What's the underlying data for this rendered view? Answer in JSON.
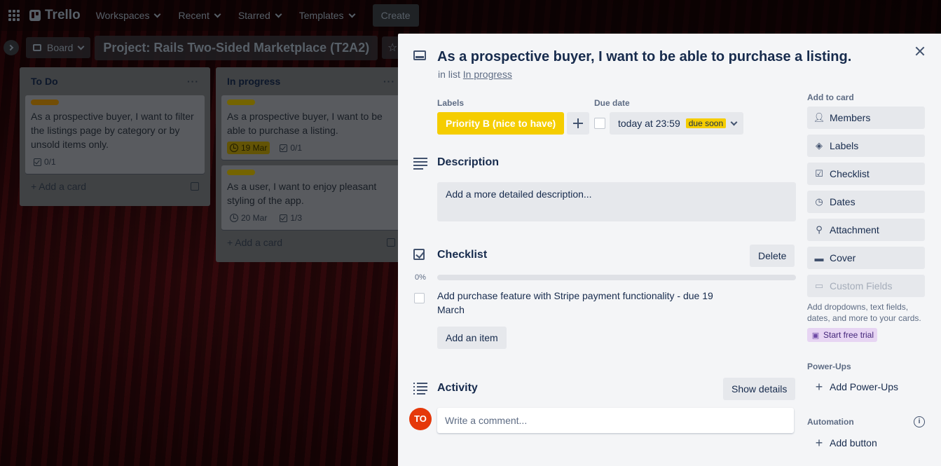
{
  "nav": {
    "logo": "Trello",
    "items": [
      "Workspaces",
      "Recent",
      "Starred",
      "Templates"
    ],
    "create": "Create"
  },
  "board": {
    "view": "Board",
    "title": "Project: Rails Two-Sided Marketplace (T2A2)"
  },
  "lists": [
    {
      "title": "To Do",
      "cards": [
        {
          "label_color": "#cf8c0a",
          "text": "As a prospective buyer, I want to filter the listings page by category or by unsold items only.",
          "checklist": "0/1"
        }
      ],
      "add_card": "Add a card"
    },
    {
      "title": "In progress",
      "cards": [
        {
          "label_color": "#d4b700",
          "text": "As a prospective buyer, I want to be able to purchase a listing.",
          "due": "19 Mar",
          "checklist": "0/1"
        },
        {
          "label_color": "#d4b700",
          "text": "As a user, I want to enjoy pleasant styling of the app.",
          "due": "20 Mar",
          "checklist": "1/3"
        }
      ],
      "add_card": "Add a card"
    }
  ],
  "modal": {
    "title": "As a prospective buyer, I want to be able to purchase a listing.",
    "in_list_prefix": "in list",
    "in_list": "In progress",
    "labels_heading": "Labels",
    "label": {
      "text": "Priority B (nice to have)",
      "color": "#f5cd00"
    },
    "due_heading": "Due date",
    "due_text": "today at 23:59",
    "due_badge": "due soon",
    "description_title": "Description",
    "description_placeholder": "Add a more detailed description...",
    "checklist_title": "Checklist",
    "checklist_delete": "Delete",
    "checklist_percent": "0%",
    "checklist_progress": 0,
    "checklist_item": "Add purchase feature with Stripe payment functionality - due 19 March",
    "add_item": "Add an item",
    "activity_title": "Activity",
    "show_details": "Show details",
    "avatar_initials": "TO",
    "comment_placeholder": "Write a comment..."
  },
  "sidebar": {
    "add_to_card_heading": "Add to card",
    "add_to_card": [
      {
        "icon": "person-icon",
        "label": "Members"
      },
      {
        "icon": "tag-icon",
        "label": "Labels"
      },
      {
        "icon": "checklist-icon",
        "label": "Checklist"
      },
      {
        "icon": "clock-icon",
        "label": "Dates"
      },
      {
        "icon": "paperclip-icon",
        "label": "Attachment"
      },
      {
        "icon": "cover-icon",
        "label": "Cover"
      }
    ],
    "custom_fields": "Custom Fields",
    "custom_fields_note": "Add dropdowns, text fields, dates, and more to your cards.",
    "trial": "Start free trial",
    "powerups_heading": "Power-Ups",
    "add_powerups": "Add Power-Ups",
    "automation_heading": "Automation",
    "add_button": "Add button"
  }
}
